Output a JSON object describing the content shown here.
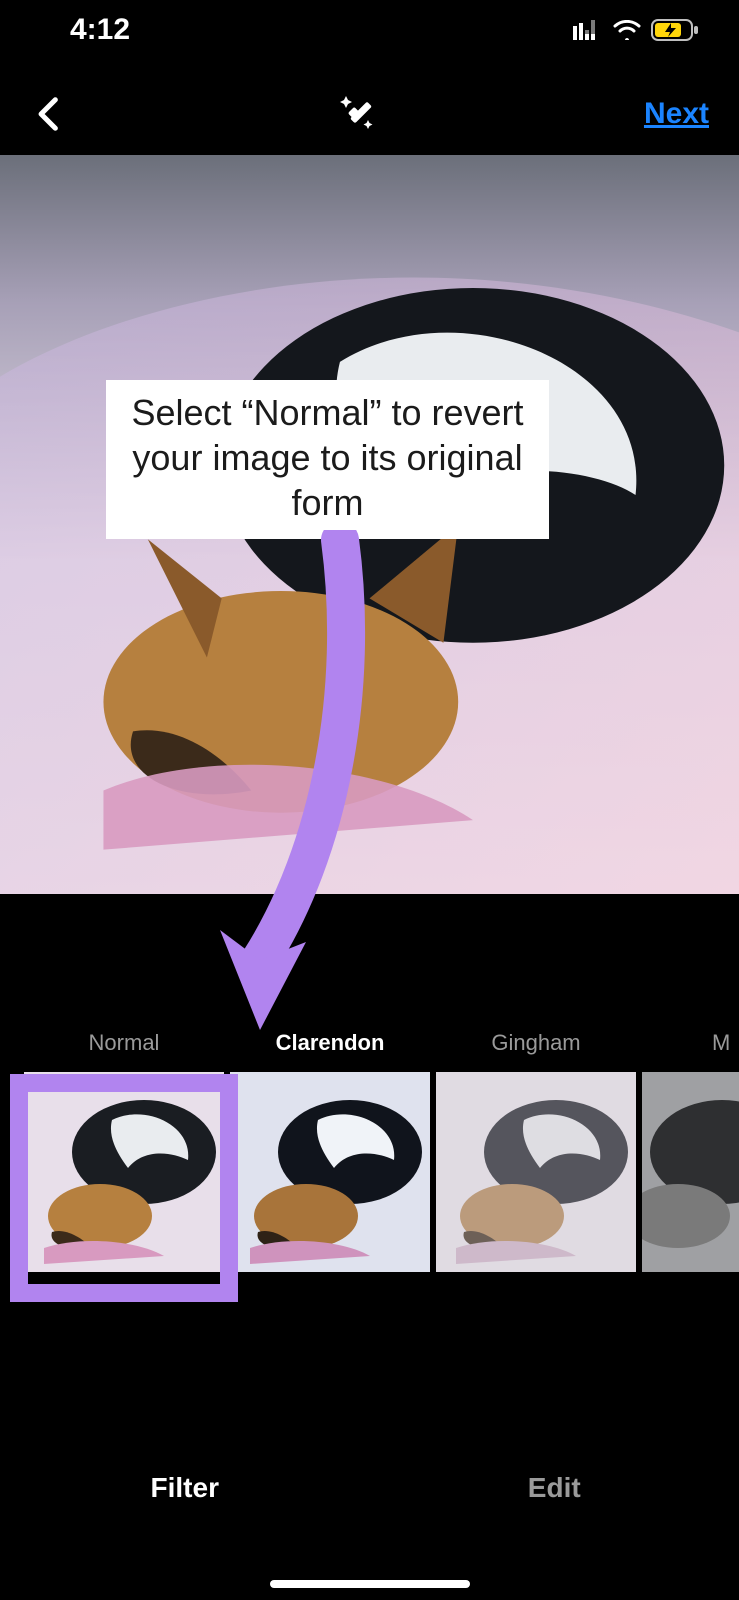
{
  "statusbar": {
    "time": "4:12"
  },
  "topnav": {
    "next_label": "Next"
  },
  "annotation": {
    "caption_text": "Select “Normal” to revert your image to its original form",
    "arrow_color": "#b184ef",
    "highlight_color": "#b184ef"
  },
  "filters": {
    "selected_index": 1,
    "highlighted_index": 0,
    "items": [
      {
        "label": "Normal"
      },
      {
        "label": "Clarendon"
      },
      {
        "label": "Gingham"
      },
      {
        "label": "M"
      }
    ]
  },
  "bottom_tabs": {
    "active_index": 0,
    "items": [
      {
        "label": "Filter"
      },
      {
        "label": "Edit"
      }
    ]
  }
}
